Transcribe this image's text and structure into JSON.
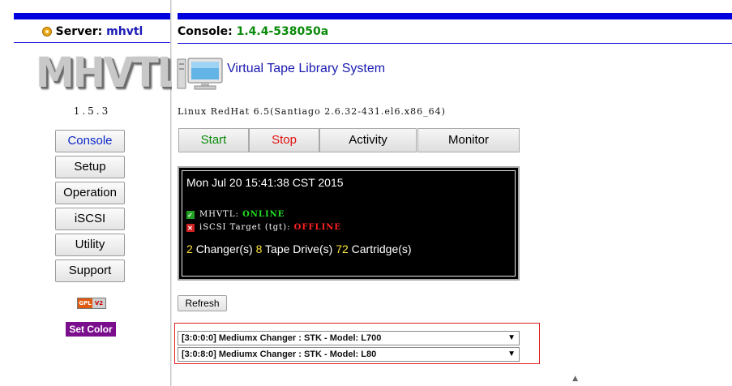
{
  "left": {
    "server_label": "Server:",
    "server_name": "mhvtl",
    "logo_text": "MHVTL",
    "version": "1.5.3",
    "nav": [
      "Console",
      "Setup",
      "Operation",
      "iSCSI",
      "Utility",
      "Support"
    ],
    "active_nav": "Console",
    "gpl_badge": {
      "left": "GPL",
      "right": "V2"
    },
    "set_color": "Set Color"
  },
  "header": {
    "console_label": "Console:",
    "console_version": "1.4.4-538050a"
  },
  "main": {
    "title": "Virtual Tape Library System",
    "os_info": "Linux RedHat 6.5(Santiago 2.6.32-431.el6.x86_64)",
    "actions": [
      "Start",
      "Stop",
      "Activity",
      "Monitor"
    ],
    "status": {
      "datetime": "Mon Jul 20 15:41:38 CST 2015",
      "services": [
        {
          "name": "MHVTL:",
          "state": "ONLINE",
          "ok": true
        },
        {
          "name": "iSCSI Target (tgt):",
          "state": "OFFLINE",
          "ok": false
        }
      ],
      "counts": {
        "changers": "2",
        "changers_label": "Changer(s)",
        "drives": "8",
        "drives_label": "Tape Drive(s)",
        "cartridges": "72",
        "cartridges_label": "Cartridge(s)"
      }
    },
    "refresh_label": "Refresh",
    "changers": [
      "[3:0:0:0] Mediumx Changer : STK - Model: L700",
      "[3:0:8:0] Mediumx Changer : STK - Model: L80"
    ]
  },
  "colors": {
    "brand_blue": "#0000dd",
    "start": "#0a8a0a",
    "stop": "#e01010",
    "online": "#22e022",
    "offline": "#ff2222",
    "count_yellow": "#ffe23a",
    "set_color_bg": "#7a0e8c"
  }
}
